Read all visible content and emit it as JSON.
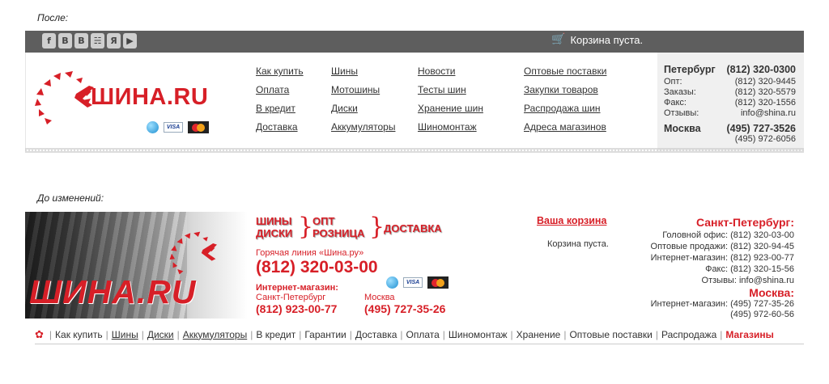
{
  "after": {
    "caption": "После:",
    "social_icons": [
      "facebook-icon",
      "vkontakte-icon",
      "vk-b-icon",
      "rss-icon",
      "yandex-icon",
      "youtube-icon"
    ],
    "social_glyphs": [
      "f",
      "В",
      "B",
      "☵",
      "Я",
      "▶"
    ],
    "cart_text": "Корзина пуста.",
    "brand": "ШИНА.RU",
    "menu_columns": [
      [
        "Как купить",
        "Оплата",
        "В кредит",
        "Доставка"
      ],
      [
        "Шины",
        "Мотошины",
        "Диски",
        "Аккумуляторы"
      ],
      [
        "Новости",
        "Тесты шин",
        "Хранение шин",
        "Шиномонтаж"
      ],
      [
        "Оптовые поставки",
        "Закупки товаров",
        "Распродажа шин",
        "Адреса магазинов"
      ]
    ],
    "contacts": {
      "spb_label": "Петербург",
      "spb_phone": "(812) 320-0300",
      "rows": [
        {
          "label": "Опт:",
          "value": "(812) 320-9445"
        },
        {
          "label": "Заказы:",
          "value": "(812) 320-5579"
        },
        {
          "label": "Факс:",
          "value": "(812) 320-1556"
        },
        {
          "label": "Отзывы:",
          "value": "info@shina.ru"
        }
      ],
      "msk_label": "Москва",
      "msk_phone": "(495) 727-3526",
      "msk_phone2": "(495) 972-6056"
    }
  },
  "before": {
    "caption": "До изменений:",
    "brand": "ШИНА.RU",
    "slogan": {
      "tires": "ШИНЫ",
      "disks": "ДИСКИ",
      "opt": "ОПТ",
      "retail": "РОЗНИЦА",
      "delivery": "ДОСТАВКА"
    },
    "hotline_label": "Горячая линия «Шина.ру»",
    "hotline_phone": "(812) 320-03-00",
    "eshop_label": "Интернет-магазин:",
    "spb_city": "Санкт-Петербург",
    "spb_phone": "(812) 923-00-77",
    "msk_city": "Москва",
    "msk_phone": "(495) 727-35-26",
    "cart_link": "Ваша корзина",
    "cart_status": "Корзина пуста.",
    "spb_title": "Санкт-Петербург:",
    "spb_lines": [
      "Головной офис: (812) 320-03-00",
      "Оптовые продажи: (812) 320-94-45",
      "Интернет-магазин: (812) 923-00-77",
      "Факс: (812) 320-15-56",
      "Отзывы: info@shina.ru"
    ],
    "msk_title": "Москва:",
    "msk_lines": [
      "Интернет-магазин: (495) 727-35-26",
      "(495) 972-60-56"
    ],
    "nav": [
      {
        "label": "Как купить",
        "u": false
      },
      {
        "label": "Шины",
        "u": true
      },
      {
        "label": "Диски",
        "u": true
      },
      {
        "label": "Аккумуляторы",
        "u": true
      },
      {
        "label": "В кредит",
        "u": false
      },
      {
        "label": "Гарантии",
        "u": false
      },
      {
        "label": "Доставка",
        "u": false
      },
      {
        "label": "Оплата",
        "u": false
      },
      {
        "label": "Шиномонтаж",
        "u": false
      },
      {
        "label": "Хранение",
        "u": false
      },
      {
        "label": "Оптовые поставки",
        "u": false
      },
      {
        "label": "Распродажа",
        "u": false
      },
      {
        "label": "Магазины",
        "u": false,
        "accent": true
      }
    ]
  },
  "colors": {
    "accent": "#d71f27",
    "bar": "#5e5e5e",
    "contact_bg": "#f0f0f0"
  }
}
